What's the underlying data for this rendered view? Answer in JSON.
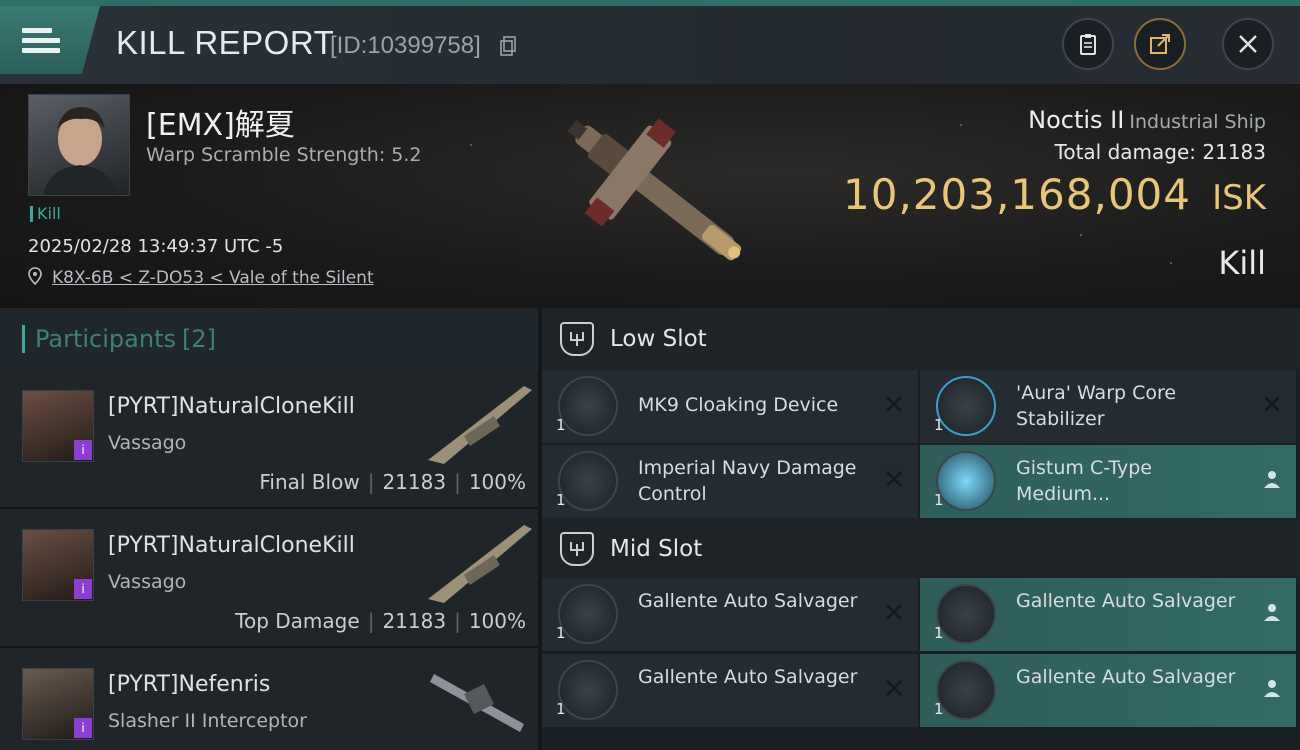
{
  "header": {
    "title": "KILL REPORT",
    "report_id": "[ID:10399758]"
  },
  "victim": {
    "name": "[EMX]解夏",
    "warp_scramble": "Warp Scramble Strength: 5.2",
    "tag": "Kill",
    "date": "2025/02/28 13:49:37 UTC -5",
    "location": "K8X-6B < Z-DO53 < Vale of the Silent"
  },
  "ship": {
    "name": "Noctis II",
    "class": "Industrial Ship",
    "damage_label": "Total damage:",
    "damage_value": "21183",
    "isk_value": "10,203,168,004",
    "isk_unit": "ISK",
    "result": "Kill"
  },
  "participants": {
    "label": "Participants",
    "count": "[2]",
    "rows": [
      {
        "name": "[PYRT]NaturalCloneKill",
        "ship": "Vassago",
        "role": "Final Blow",
        "damage": "21183",
        "percent": "100%",
        "badge": "i"
      },
      {
        "name": "[PYRT]NaturalCloneKill",
        "ship": "Vassago",
        "role": "Top Damage",
        "damage": "21183",
        "percent": "100%",
        "badge": "i"
      },
      {
        "name": "[PYRT]Nefenris",
        "ship": "Slasher II Interceptor",
        "badge": "i"
      }
    ]
  },
  "fitting": {
    "low_slot": {
      "title": "Low Slot",
      "modules": [
        {
          "qty": "1",
          "name": "MK9 Cloaking Device",
          "status": "destroyed"
        },
        {
          "qty": "1",
          "name": "'Aura' Warp Core Stabilizer",
          "status": "destroyed"
        },
        {
          "qty": "1",
          "name": "Imperial Navy Damage Control",
          "status": "destroyed"
        },
        {
          "qty": "1",
          "name": "Gistum C-Type Medium...",
          "status": "dropped"
        }
      ]
    },
    "mid_slot": {
      "title": "Mid Slot",
      "modules": [
        {
          "qty": "1",
          "name": "Gallente Auto Salvager",
          "status": "destroyed"
        },
        {
          "qty": "1",
          "name": "Gallente Auto Salvager",
          "status": "dropped"
        },
        {
          "qty": "1",
          "name": "Gallente Auto Salvager",
          "status": "destroyed"
        },
        {
          "qty": "1",
          "name": "Gallente Auto Salvager",
          "status": "dropped"
        }
      ]
    }
  },
  "colors": {
    "accent": "#3fa89c",
    "isk": "#e9c57a",
    "dropped_bg": "#346a66",
    "badge": "#8b3fd0"
  }
}
